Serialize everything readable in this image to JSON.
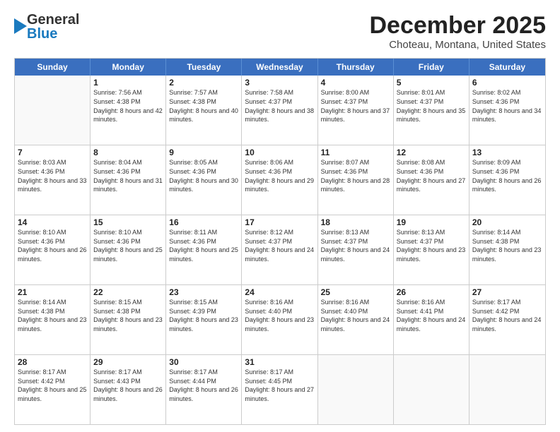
{
  "header": {
    "logo": {
      "line1": "General",
      "line2": "Blue"
    },
    "title": "December 2025",
    "subtitle": "Choteau, Montana, United States"
  },
  "weekdays": [
    "Sunday",
    "Monday",
    "Tuesday",
    "Wednesday",
    "Thursday",
    "Friday",
    "Saturday"
  ],
  "weeks": [
    [
      {
        "day": "",
        "sunrise": "",
        "sunset": "",
        "daylight": ""
      },
      {
        "day": "1",
        "sunrise": "Sunrise: 7:56 AM",
        "sunset": "Sunset: 4:38 PM",
        "daylight": "Daylight: 8 hours and 42 minutes."
      },
      {
        "day": "2",
        "sunrise": "Sunrise: 7:57 AM",
        "sunset": "Sunset: 4:38 PM",
        "daylight": "Daylight: 8 hours and 40 minutes."
      },
      {
        "day": "3",
        "sunrise": "Sunrise: 7:58 AM",
        "sunset": "Sunset: 4:37 PM",
        "daylight": "Daylight: 8 hours and 38 minutes."
      },
      {
        "day": "4",
        "sunrise": "Sunrise: 8:00 AM",
        "sunset": "Sunset: 4:37 PM",
        "daylight": "Daylight: 8 hours and 37 minutes."
      },
      {
        "day": "5",
        "sunrise": "Sunrise: 8:01 AM",
        "sunset": "Sunset: 4:37 PM",
        "daylight": "Daylight: 8 hours and 35 minutes."
      },
      {
        "day": "6",
        "sunrise": "Sunrise: 8:02 AM",
        "sunset": "Sunset: 4:36 PM",
        "daylight": "Daylight: 8 hours and 34 minutes."
      }
    ],
    [
      {
        "day": "7",
        "sunrise": "Sunrise: 8:03 AM",
        "sunset": "Sunset: 4:36 PM",
        "daylight": "Daylight: 8 hours and 33 minutes."
      },
      {
        "day": "8",
        "sunrise": "Sunrise: 8:04 AM",
        "sunset": "Sunset: 4:36 PM",
        "daylight": "Daylight: 8 hours and 31 minutes."
      },
      {
        "day": "9",
        "sunrise": "Sunrise: 8:05 AM",
        "sunset": "Sunset: 4:36 PM",
        "daylight": "Daylight: 8 hours and 30 minutes."
      },
      {
        "day": "10",
        "sunrise": "Sunrise: 8:06 AM",
        "sunset": "Sunset: 4:36 PM",
        "daylight": "Daylight: 8 hours and 29 minutes."
      },
      {
        "day": "11",
        "sunrise": "Sunrise: 8:07 AM",
        "sunset": "Sunset: 4:36 PM",
        "daylight": "Daylight: 8 hours and 28 minutes."
      },
      {
        "day": "12",
        "sunrise": "Sunrise: 8:08 AM",
        "sunset": "Sunset: 4:36 PM",
        "daylight": "Daylight: 8 hours and 27 minutes."
      },
      {
        "day": "13",
        "sunrise": "Sunrise: 8:09 AM",
        "sunset": "Sunset: 4:36 PM",
        "daylight": "Daylight: 8 hours and 26 minutes."
      }
    ],
    [
      {
        "day": "14",
        "sunrise": "Sunrise: 8:10 AM",
        "sunset": "Sunset: 4:36 PM",
        "daylight": "Daylight: 8 hours and 26 minutes."
      },
      {
        "day": "15",
        "sunrise": "Sunrise: 8:10 AM",
        "sunset": "Sunset: 4:36 PM",
        "daylight": "Daylight: 8 hours and 25 minutes."
      },
      {
        "day": "16",
        "sunrise": "Sunrise: 8:11 AM",
        "sunset": "Sunset: 4:36 PM",
        "daylight": "Daylight: 8 hours and 25 minutes."
      },
      {
        "day": "17",
        "sunrise": "Sunrise: 8:12 AM",
        "sunset": "Sunset: 4:37 PM",
        "daylight": "Daylight: 8 hours and 24 minutes."
      },
      {
        "day": "18",
        "sunrise": "Sunrise: 8:13 AM",
        "sunset": "Sunset: 4:37 PM",
        "daylight": "Daylight: 8 hours and 24 minutes."
      },
      {
        "day": "19",
        "sunrise": "Sunrise: 8:13 AM",
        "sunset": "Sunset: 4:37 PM",
        "daylight": "Daylight: 8 hours and 23 minutes."
      },
      {
        "day": "20",
        "sunrise": "Sunrise: 8:14 AM",
        "sunset": "Sunset: 4:38 PM",
        "daylight": "Daylight: 8 hours and 23 minutes."
      }
    ],
    [
      {
        "day": "21",
        "sunrise": "Sunrise: 8:14 AM",
        "sunset": "Sunset: 4:38 PM",
        "daylight": "Daylight: 8 hours and 23 minutes."
      },
      {
        "day": "22",
        "sunrise": "Sunrise: 8:15 AM",
        "sunset": "Sunset: 4:38 PM",
        "daylight": "Daylight: 8 hours and 23 minutes."
      },
      {
        "day": "23",
        "sunrise": "Sunrise: 8:15 AM",
        "sunset": "Sunset: 4:39 PM",
        "daylight": "Daylight: 8 hours and 23 minutes."
      },
      {
        "day": "24",
        "sunrise": "Sunrise: 8:16 AM",
        "sunset": "Sunset: 4:40 PM",
        "daylight": "Daylight: 8 hours and 23 minutes."
      },
      {
        "day": "25",
        "sunrise": "Sunrise: 8:16 AM",
        "sunset": "Sunset: 4:40 PM",
        "daylight": "Daylight: 8 hours and 24 minutes."
      },
      {
        "day": "26",
        "sunrise": "Sunrise: 8:16 AM",
        "sunset": "Sunset: 4:41 PM",
        "daylight": "Daylight: 8 hours and 24 minutes."
      },
      {
        "day": "27",
        "sunrise": "Sunrise: 8:17 AM",
        "sunset": "Sunset: 4:42 PM",
        "daylight": "Daylight: 8 hours and 24 minutes."
      }
    ],
    [
      {
        "day": "28",
        "sunrise": "Sunrise: 8:17 AM",
        "sunset": "Sunset: 4:42 PM",
        "daylight": "Daylight: 8 hours and 25 minutes."
      },
      {
        "day": "29",
        "sunrise": "Sunrise: 8:17 AM",
        "sunset": "Sunset: 4:43 PM",
        "daylight": "Daylight: 8 hours and 26 minutes."
      },
      {
        "day": "30",
        "sunrise": "Sunrise: 8:17 AM",
        "sunset": "Sunset: 4:44 PM",
        "daylight": "Daylight: 8 hours and 26 minutes."
      },
      {
        "day": "31",
        "sunrise": "Sunrise: 8:17 AM",
        "sunset": "Sunset: 4:45 PM",
        "daylight": "Daylight: 8 hours and 27 minutes."
      },
      {
        "day": "",
        "sunrise": "",
        "sunset": "",
        "daylight": ""
      },
      {
        "day": "",
        "sunrise": "",
        "sunset": "",
        "daylight": ""
      },
      {
        "day": "",
        "sunrise": "",
        "sunset": "",
        "daylight": ""
      }
    ]
  ]
}
